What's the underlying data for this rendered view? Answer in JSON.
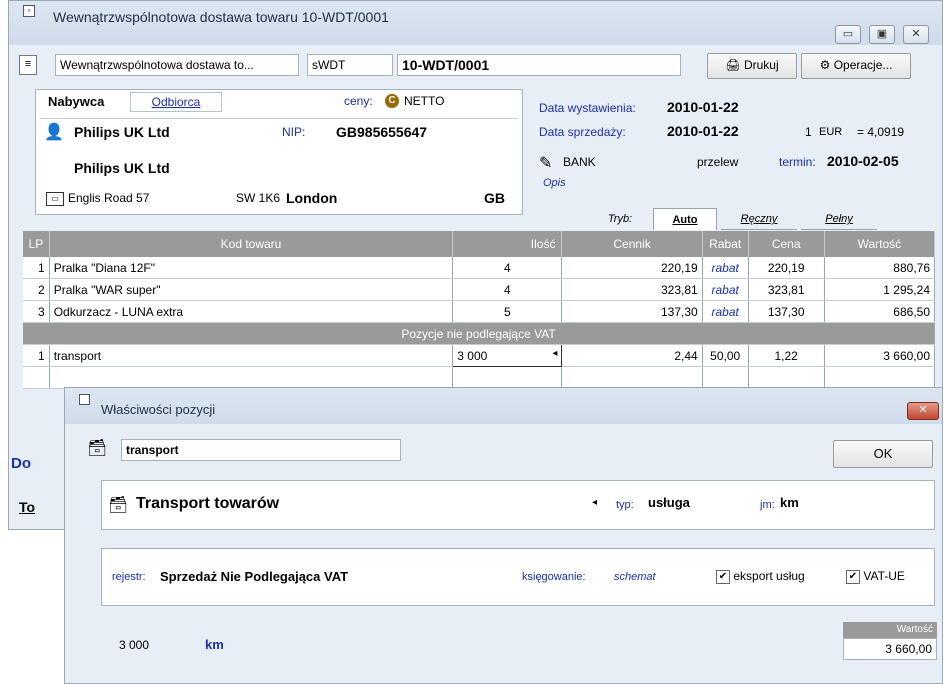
{
  "window": {
    "title": "Wewnątrzwspólnotowa dostawa towaru 10-WDT/0001",
    "buttons": {
      "minimize": "▭",
      "maximize": "▣",
      "close": "✕"
    }
  },
  "toolbar": {
    "doc_type": "Wewnątrzwspólnotowa dostawa to...",
    "doc_code": "sWDT",
    "doc_number": "10-WDT/0001",
    "print_label": "Drukuj",
    "operations_label": "Operacje..."
  },
  "buyer": {
    "tab_buyer": "Nabywca",
    "tab_recipient": "Odbiorca",
    "prices_label": "ceny:",
    "prices_value": "NETTO",
    "name": "Philips UK Ltd",
    "nip_label": "NIP:",
    "nip_value": "GB985655647",
    "name2": "Philips UK Ltd",
    "street": "Englis Road 57",
    "postcode": "SW 1K6",
    "city": "London",
    "country": "GB"
  },
  "dates": {
    "issue_label": "Data wystawienia:",
    "issue_value": "2010-01-22",
    "sale_label": "Data sprzedaży:",
    "sale_value": "2010-01-22",
    "rate_qty": "1",
    "rate_currency": "EUR",
    "rate_value": "= 4,0919",
    "payment_name": "BANK",
    "payment_type": "przelew",
    "term_label": "termin:",
    "term_value": "2010-02-05",
    "desc_label": "Opis"
  },
  "mode": {
    "label": "Tryb:",
    "tabs": [
      "Auto",
      "Ręczny",
      "Pełny"
    ]
  },
  "grid": {
    "headers": [
      "LP",
      "Kod towaru",
      "Ilość",
      "Cennik",
      "Rabat",
      "Cena",
      "Wartość"
    ],
    "rows": [
      {
        "lp": "1",
        "code": "Pralka \"Diana 12F\"",
        "qty": "4",
        "list": "220,19",
        "disc": "rabat",
        "price": "220,19",
        "value": "880,76"
      },
      {
        "lp": "2",
        "code": "Pralka \"WAR super\"",
        "qty": "4",
        "list": "323,81",
        "disc": "rabat",
        "price": "323,81",
        "value": "1 295,24"
      },
      {
        "lp": "3",
        "code": "Odkurzacz - LUNA extra",
        "qty": "5",
        "list": "137,30",
        "disc": "rabat",
        "price": "137,30",
        "value": "686,50"
      }
    ],
    "section_label": "Pozycje nie podlegające VAT",
    "nonvat_row": {
      "lp": "1",
      "code": "transport",
      "qty": "3 000",
      "list": "2,44",
      "disc": "50,00",
      "price": "1,22",
      "value": "3 660,00"
    }
  },
  "under": {
    "label_do": "Do",
    "label_to": "To"
  },
  "dialog": {
    "title": "Właściwości pozycji",
    "close": "✕",
    "item_name": "transport",
    "ok_label": "OK",
    "product_name": "Transport towarów",
    "type_label": "typ:",
    "type_value": "usługa",
    "unit_label": "jm:",
    "unit_value": "km",
    "register_label": "rejestr:",
    "register_value": "Sprzedaż Nie Podlegająca VAT",
    "booking_label": "księgowanie:",
    "booking_value": "schemat",
    "export_label": "eksport usług",
    "vatue_label": "VAT-UE",
    "quantity": "3 000",
    "quantity_unit": "km",
    "value_label": "Wartość",
    "value": "3 660,00"
  }
}
